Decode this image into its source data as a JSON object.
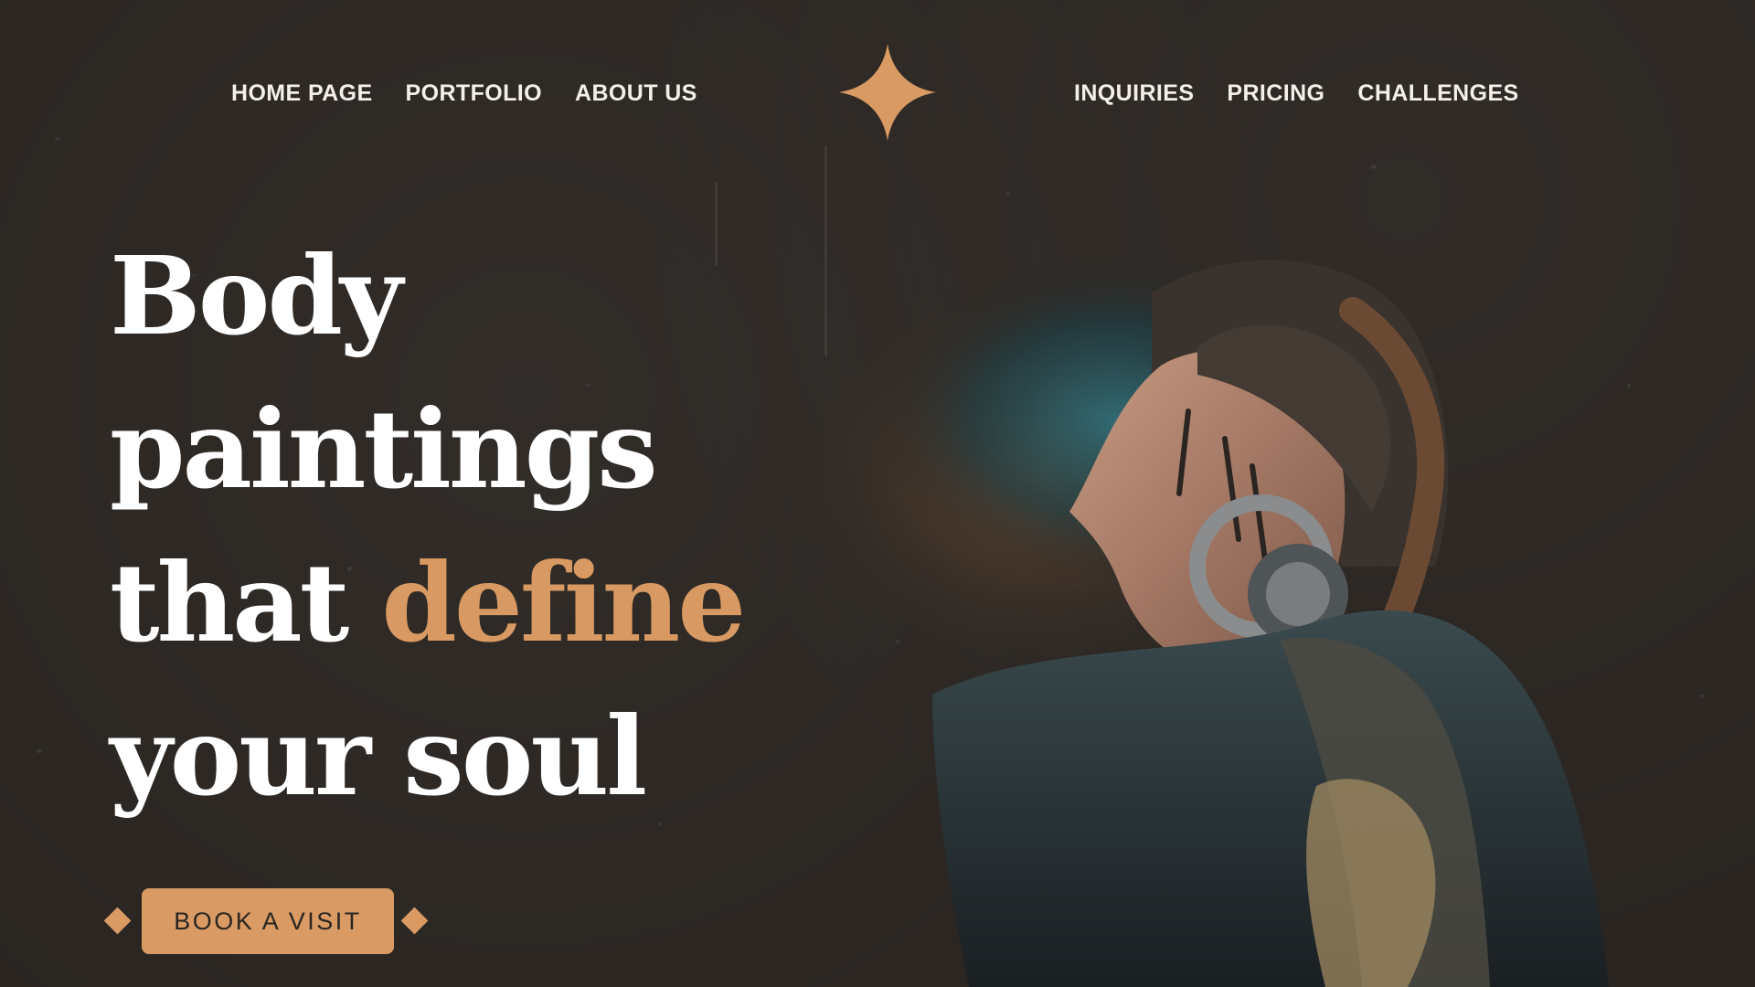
{
  "nav": {
    "left": [
      {
        "label": "HOME PAGE"
      },
      {
        "label": "PORTFOLIO"
      },
      {
        "label": "ABOUT US"
      }
    ],
    "right": [
      {
        "label": "INQUIRIES"
      },
      {
        "label": "PRICING"
      },
      {
        "label": "CHALLENGES"
      }
    ]
  },
  "hero": {
    "line1": "Body",
    "line2": "paintings",
    "line3_a": "that ",
    "line3_b": "define",
    "line4": "your soul"
  },
  "cta": {
    "label": "BOOK A VISIT"
  },
  "colors": {
    "background": "#2a2521",
    "accent": "#d99b63",
    "text": "#ffffff"
  },
  "icons": {
    "logo": "four-point-star-icon",
    "cta_decor": "diamond-icon"
  }
}
